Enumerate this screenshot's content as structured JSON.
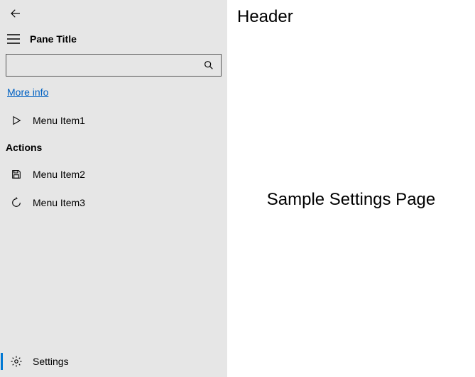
{
  "pane": {
    "title": "Pane Title",
    "search_placeholder": "",
    "more_link": "More info",
    "section_header": "Actions",
    "items": {
      "item1": "Menu Item1",
      "item2": "Menu Item2",
      "item3": "Menu Item3"
    },
    "footer_label": "Settings"
  },
  "content": {
    "header": "Header",
    "body": "Sample Settings Page"
  }
}
